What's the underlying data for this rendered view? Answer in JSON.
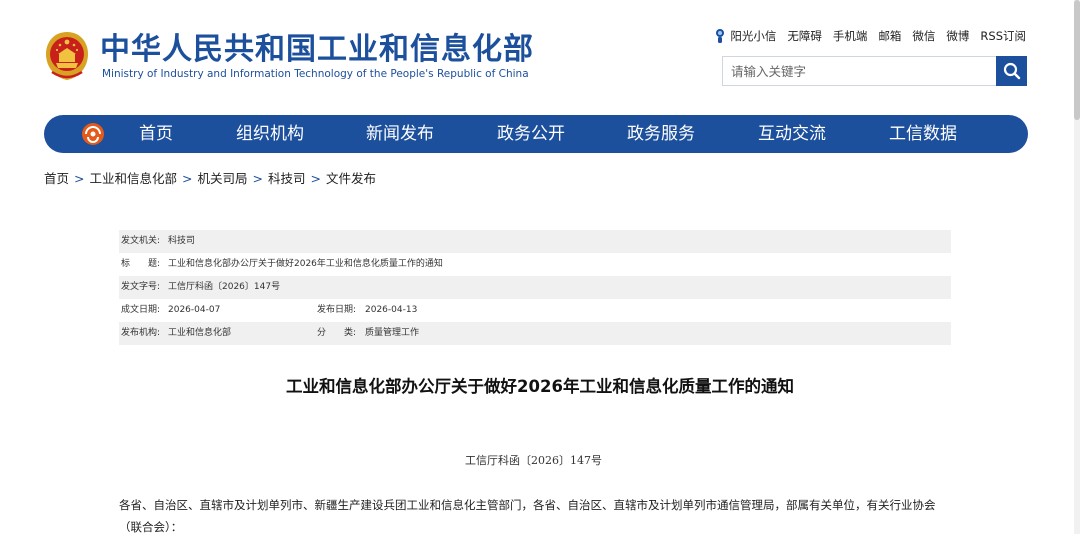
{
  "header": {
    "title_cn": "中华人民共和国工业和信息化部",
    "title_en": "Ministry of Industry and Information Technology of the People's Republic of China",
    "top_links": [
      "阳光小信",
      "无障碍",
      "手机端",
      "邮箱",
      "微信",
      "微博",
      "RSS订阅"
    ],
    "search_placeholder": "请输入关键字",
    "brand_color": "#1c4f9c"
  },
  "nav": {
    "items": [
      "首页",
      "组织机构",
      "新闻发布",
      "政务公开",
      "政务服务",
      "互动交流",
      "工信数据"
    ]
  },
  "breadcrumb": [
    "首页",
    "工业和信息化部",
    "机关司局",
    "科技司",
    "文件发布"
  ],
  "info": {
    "issuer_label": "发文机关:",
    "issuer": "科技司",
    "title_label": "标　　题:",
    "title": "工业和信息化部办公厅关于做好2026年工业和信息化质量工作的通知",
    "number_label": "发文字号:",
    "number": "工信厅科函〔2026〕147号",
    "created_label": "成文日期:",
    "created": "2026-04-07",
    "published_label": "发布日期:",
    "published": "2026-04-13",
    "agency_label": "发布机构:",
    "agency": "工业和信息化部",
    "category_label": "分　　类:",
    "category": "质量管理工作"
  },
  "document": {
    "title": "工业和信息化部办公厅关于做好2026年工业和信息化质量工作的通知",
    "number": "工信厅科函〔2026〕147号",
    "paragraph": "各省、自治区、直辖市及计划单列市、新疆生产建设兵团工业和信息化主管部门，各省、自治区、直辖市及计划单列市通信管理局，部属有关单位，有关行业协会（联合会）："
  }
}
